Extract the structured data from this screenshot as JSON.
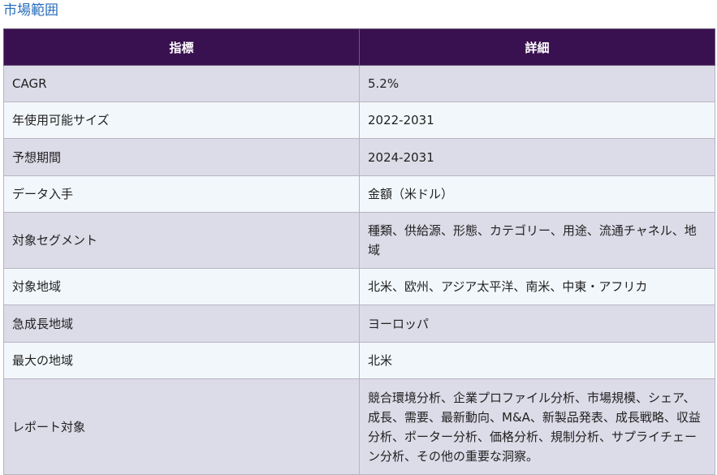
{
  "heading": "市場範囲",
  "table": {
    "headers": [
      "指標",
      "詳細"
    ],
    "rows": [
      {
        "metric": "CAGR",
        "detail": "5.2%"
      },
      {
        "metric": "年使用可能サイズ",
        "detail": "2022-2031"
      },
      {
        "metric": "予想期間",
        "detail": "2024-2031"
      },
      {
        "metric": "データ入手",
        "detail": "金額（米ドル）"
      },
      {
        "metric": "対象セグメント",
        "detail": "種類、供給源、形態、カテゴリー、用途、流通チャネル、地域"
      },
      {
        "metric": "対象地域",
        "detail": "北米、欧州、アジア太平洋、南米、中東・アフリカ"
      },
      {
        "metric": "急成長地域",
        "detail": "ヨーロッパ"
      },
      {
        "metric": "最大の地域",
        "detail": "北米"
      },
      {
        "metric": "レポート対象",
        "detail": "競合環境分析、企業プロファイル分析、市場規模、シェア、成長、需要、最新動向、M&A、新製品発表、成長戦略、収益分析、ポーター分析、価格分析、規制分析、サプライチェーン分析、その他の重要な洞察。"
      }
    ]
  }
}
